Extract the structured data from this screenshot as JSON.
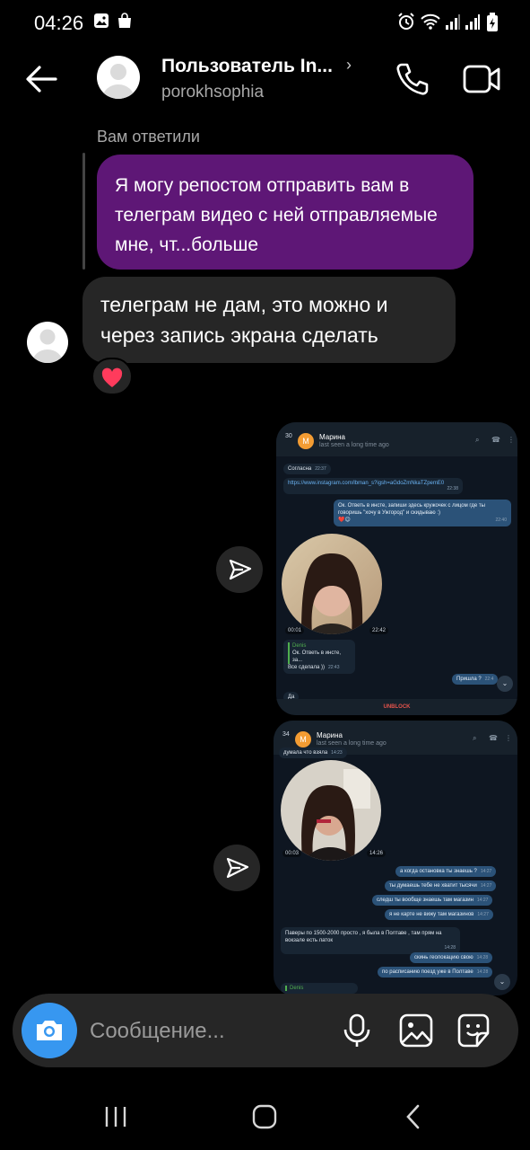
{
  "status_bar": {
    "time": "04:26"
  },
  "header": {
    "contact_name": "Пользователь In...",
    "username": "porokhsophia"
  },
  "conversation": {
    "reply_label": "Вам ответили",
    "replied_message": "Я могу репостом отправить вам в телеграм видео с ней отправляемые мне, чт...больше",
    "incoming_message": "телеграм не дам, это можно и через запись экрана сделать",
    "reaction": "❤️"
  },
  "screenshot1": {
    "badge": "30",
    "avatar_letter": "M",
    "contact": "Марина",
    "seen": "last seen a long time ago",
    "msg_agreed": "Согласна",
    "msg_agreed_time": "22:37",
    "msg_link": "https://www.instagram.com/lbman_s?igsh=aGdoZmNkaTZpemE0",
    "msg_link_time": "22:38",
    "msg_out": "Ок. Ответь в инсте, запиши здесь кружочек с лицом где ты говоришь \"хочу в Ужгород\" и скидываю :)",
    "msg_out_time": "22:40",
    "video_time": "00:01",
    "video_sent": "22:42",
    "reply_author": "Denis",
    "reply_quote": "Ок. Ответь в инсте, за...",
    "reply_text": "Все сделала ))",
    "reply_time": "22:43",
    "msg_arrived": "Пришла ?",
    "msg_arrived_time": "22:4",
    "msg_partial": "Да",
    "unblock": "UNBLOCK"
  },
  "screenshot2": {
    "badge": "34",
    "avatar_letter": "M",
    "contact": "Марина",
    "seen": "last seen a long time ago",
    "msg_top": "думала что взяла",
    "msg_top_time": "14:23",
    "video_time": "00:03",
    "video_sent": "14:26",
    "out1": "а когда остановка ты знаешь ?",
    "out2": "ты думаешь тебе не хватит тысячи",
    "out3": "следш ты вообще знаешь там магазин",
    "out4": "я не карте не вижу там магазинов",
    "out_time": "14:27",
    "in_long": "Паверы по 1500-2000 просто , я была в Полтаве , там прям на вокзале есть латок",
    "in_long_time": "14:28",
    "out5": "скинь геолокацию свою",
    "out5_time": "14:28",
    "out6": "по расписанию поезд уже в Полтаве",
    "out6_time": "14:28",
    "reply_author": "Denis"
  },
  "composer": {
    "placeholder": "Сообщение..."
  },
  "colors": {
    "accent_purple": "#5e1776",
    "bubble_grey": "#262626",
    "camera_blue": "#3797f0"
  }
}
